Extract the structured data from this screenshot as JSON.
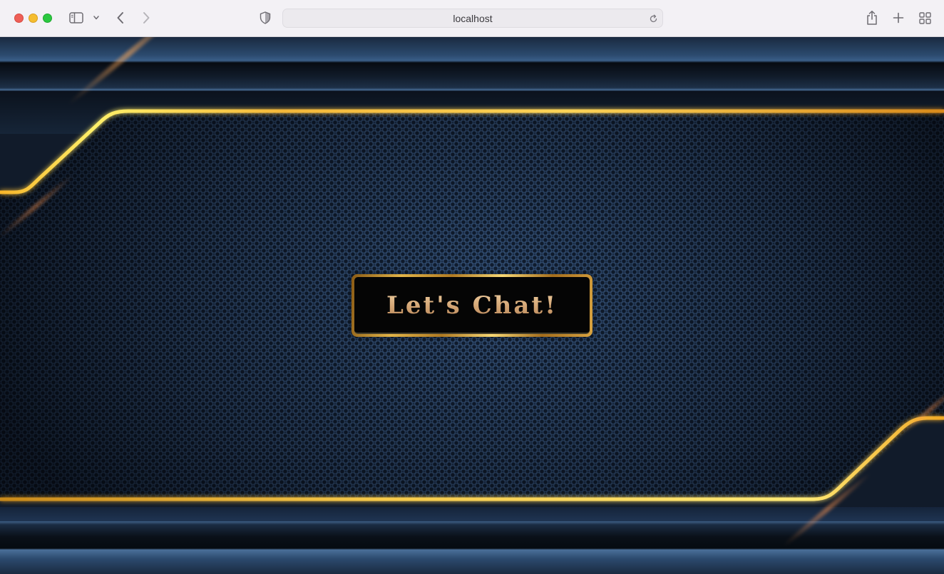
{
  "browser": {
    "address": "localhost",
    "icons": {
      "sidebar": "sidebar-icon",
      "chevron": "chevron-down-icon",
      "back": "chevron-left-icon",
      "forward": "chevron-right-icon",
      "privacy": "shield-icon",
      "reload": "reload-icon",
      "share": "share-icon",
      "new_tab": "plus-icon",
      "tab_overview": "grid-icon"
    }
  },
  "page": {
    "cta_label": "Let's Chat!"
  },
  "colors": {
    "gold": "#f5c542",
    "background": "#111b2a",
    "cta_text": "#d9b07c"
  }
}
